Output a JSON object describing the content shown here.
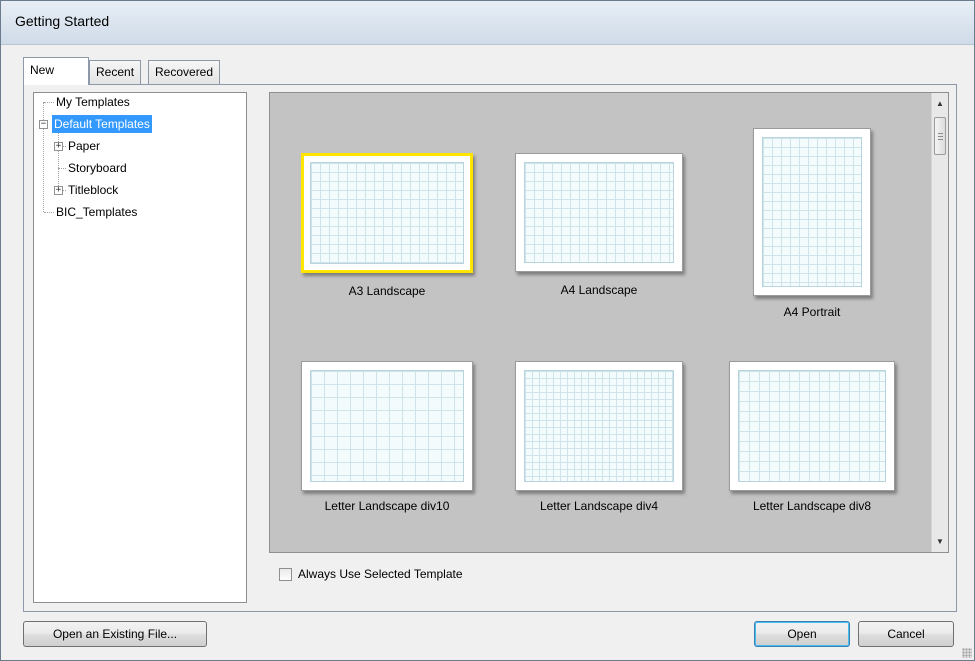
{
  "window": {
    "title": "Getting Started"
  },
  "tabs": [
    {
      "label": "New",
      "active": true
    },
    {
      "label": "Recent",
      "active": false
    },
    {
      "label": "Recovered",
      "active": false
    }
  ],
  "tree": {
    "items": [
      {
        "label": "My Templates",
        "expander": ""
      },
      {
        "label": "Default Templates",
        "expander": "−",
        "selected": true
      },
      {
        "label": "Paper",
        "expander": "+"
      },
      {
        "label": "Storyboard",
        "expander": ""
      },
      {
        "label": "Titleblock",
        "expander": "+"
      },
      {
        "label": "BIC_Templates",
        "expander": ""
      }
    ]
  },
  "templates": [
    {
      "label": "A3 Landscape",
      "selected": true
    },
    {
      "label": "A4 Landscape",
      "selected": false
    },
    {
      "label": "A4 Portrait",
      "selected": false
    },
    {
      "label": "Letter Landscape div10",
      "selected": false
    },
    {
      "label": "Letter Landscape div4",
      "selected": false
    },
    {
      "label": "Letter Landscape div8",
      "selected": false
    }
  ],
  "scrollbar": {
    "up_icon": "▲",
    "down_icon": "▼"
  },
  "options": {
    "always_use_label": "Always Use Selected Template",
    "always_use_checked": false
  },
  "buttons": {
    "open_existing": "Open an Existing File...",
    "open": "Open",
    "cancel": "Cancel"
  },
  "colors": {
    "selection": "#3399ff",
    "template_highlight": "#ffe500",
    "gallery_bg": "#c3c3c3"
  }
}
